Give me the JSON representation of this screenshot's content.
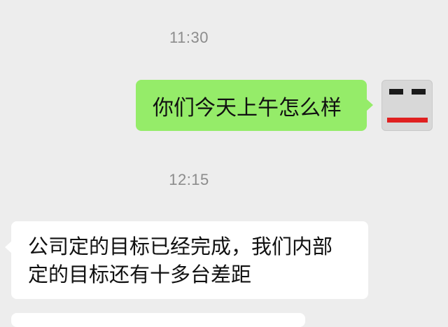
{
  "chat": {
    "messages": [
      {
        "type": "timestamp",
        "text": "11:30"
      },
      {
        "type": "outgoing",
        "text": "你们今天上午怎么样",
        "avatar": "red-mouth-face-avatar"
      },
      {
        "type": "timestamp",
        "text": "12:15"
      },
      {
        "type": "incoming",
        "lines": [
          "公司定的目标已经完成，我们内部",
          "定的目标还有十多台差距"
        ]
      }
    ]
  },
  "colors": {
    "background": "#ededed",
    "outgoing_bubble": "#95ec69",
    "incoming_bubble": "#ffffff",
    "timestamp_text": "#8c8c8c",
    "avatar_mouth": "#e02020"
  }
}
